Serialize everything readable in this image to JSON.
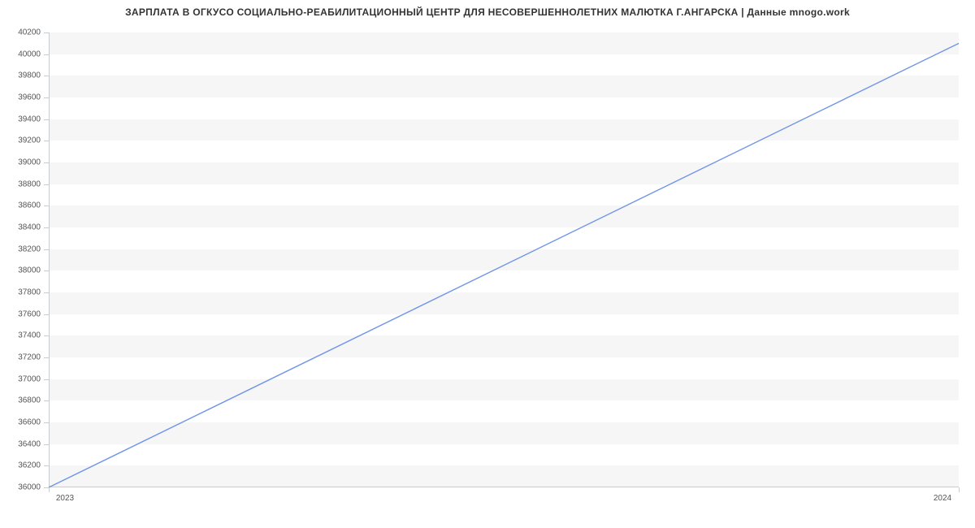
{
  "chart_data": {
    "type": "line",
    "title": "ЗАРПЛАТА В ОГКУСО СОЦИАЛЬНО-РЕАБИЛИТАЦИОННЫЙ ЦЕНТР ДЛЯ НЕСОВЕРШЕННОЛЕТНИХ МАЛЮТКА Г.АНГАРСКА | Данные mnogo.work",
    "xlabel": "",
    "ylabel": "",
    "x": [
      "2023",
      "2024"
    ],
    "values": [
      36000,
      40100
    ],
    "x_ticks": [
      "2023",
      "2024"
    ],
    "y_ticks": [
      36000,
      36200,
      36400,
      36600,
      36800,
      37000,
      37200,
      37400,
      37600,
      37800,
      38000,
      38200,
      38400,
      38600,
      38800,
      39000,
      39200,
      39400,
      39600,
      39800,
      40000,
      40200
    ],
    "ylim": [
      36000,
      40200
    ],
    "xlim": [
      0,
      1
    ],
    "grid_bands": true,
    "line_color": "#6f94e8"
  }
}
